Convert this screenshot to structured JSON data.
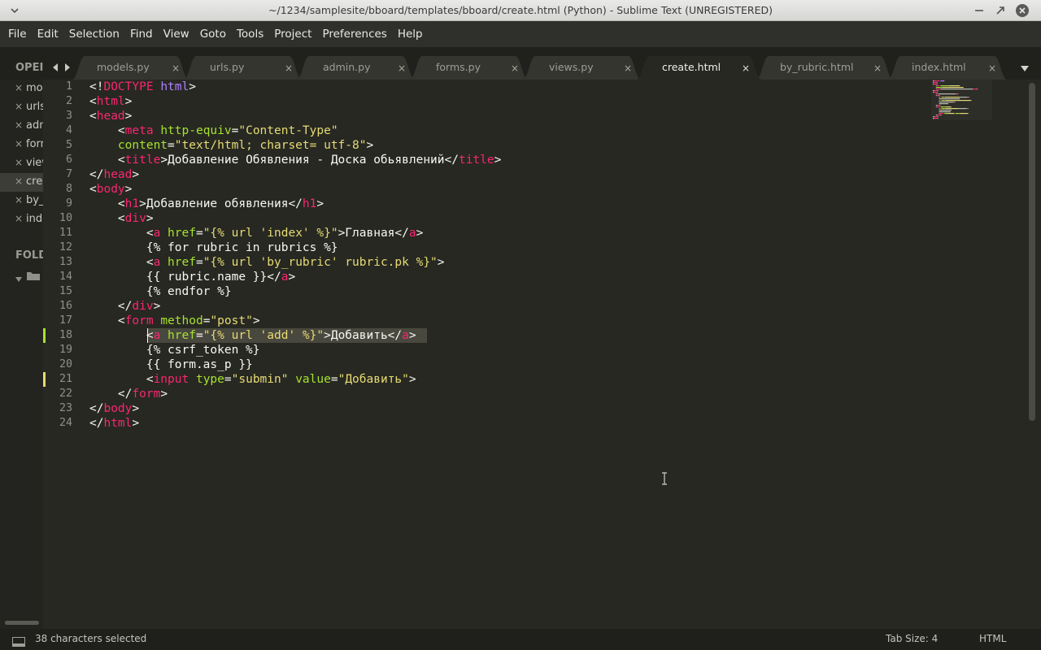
{
  "window": {
    "title": "~/1234/samplesite/bboard/templates/bboard/create.html (Python) - Sublime Text (UNREGISTERED)"
  },
  "menu": [
    "File",
    "Edit",
    "Selection",
    "Find",
    "View",
    "Goto",
    "Tools",
    "Project",
    "Preferences",
    "Help"
  ],
  "sidebar": {
    "open_label": "OPEI",
    "folders_label": "FOLD",
    "open_files": [
      {
        "name": "models.py",
        "active": false
      },
      {
        "name": "urls.py",
        "active": false
      },
      {
        "name": "admin.py",
        "active": false
      },
      {
        "name": "forms.py",
        "active": false
      },
      {
        "name": "views.py",
        "active": false
      },
      {
        "name": "create.html",
        "active": true
      },
      {
        "name": "by_rubric.html",
        "active": false
      },
      {
        "name": "index.html",
        "active": false
      }
    ]
  },
  "tabs": [
    {
      "label": "models.py",
      "active": false,
      "close": "×"
    },
    {
      "label": "urls.py",
      "active": false,
      "close": "×"
    },
    {
      "label": "admin.py",
      "active": false,
      "close": "×"
    },
    {
      "label": "forms.py",
      "active": false,
      "close": "×"
    },
    {
      "label": "views.py",
      "active": false,
      "close": "×"
    },
    {
      "label": "create.html",
      "active": true,
      "close": "×"
    },
    {
      "label": "by_rubric.html",
      "active": false,
      "close": "×"
    },
    {
      "label": "index.html",
      "active": false,
      "close": "×"
    }
  ],
  "editor": {
    "current_line": 18,
    "lines": [
      [
        [
          "p",
          "<!"
        ],
        [
          "t",
          "DOCTYPE"
        ],
        [
          "p",
          " "
        ],
        [
          "k",
          "html"
        ],
        [
          "p",
          ">"
        ]
      ],
      [
        [
          "p",
          "<"
        ],
        [
          "t",
          "html"
        ],
        [
          "p",
          ">"
        ]
      ],
      [
        [
          "p",
          "<"
        ],
        [
          "t",
          "head"
        ],
        [
          "p",
          ">"
        ]
      ],
      [
        [
          "p",
          "    <"
        ],
        [
          "t",
          "meta"
        ],
        [
          "p",
          " "
        ],
        [
          "a",
          "http-equiv"
        ],
        [
          "p",
          "="
        ],
        [
          "s",
          "\"Content-Type\""
        ]
      ],
      [
        [
          "p",
          "    "
        ],
        [
          "a",
          "content"
        ],
        [
          "p",
          "="
        ],
        [
          "s",
          "\"text/html; charset= utf-8\""
        ],
        [
          "p",
          ">"
        ]
      ],
      [
        [
          "p",
          "    <"
        ],
        [
          "t",
          "title"
        ],
        [
          "p",
          ">Добавление Обявления - Доска обьявлений</"
        ],
        [
          "t",
          "title"
        ],
        [
          "p",
          ">"
        ]
      ],
      [
        [
          "p",
          "</"
        ],
        [
          "t",
          "head"
        ],
        [
          "p",
          ">"
        ]
      ],
      [
        [
          "p",
          "<"
        ],
        [
          "t",
          "body"
        ],
        [
          "p",
          ">"
        ]
      ],
      [
        [
          "p",
          "    <"
        ],
        [
          "t",
          "h1"
        ],
        [
          "p",
          ">Добавление обявления</"
        ],
        [
          "t",
          "h1"
        ],
        [
          "p",
          ">"
        ]
      ],
      [
        [
          "p",
          "    <"
        ],
        [
          "t",
          "div"
        ],
        [
          "p",
          ">"
        ]
      ],
      [
        [
          "p",
          "        <"
        ],
        [
          "t",
          "a"
        ],
        [
          "p",
          " "
        ],
        [
          "a",
          "href"
        ],
        [
          "p",
          "="
        ],
        [
          "s",
          "\"{% url 'index' %}\""
        ],
        [
          "p",
          ">Главная</"
        ],
        [
          "t",
          "a"
        ],
        [
          "p",
          ">"
        ]
      ],
      [
        [
          "p",
          "        {% for rubric in rubrics %}"
        ]
      ],
      [
        [
          "p",
          "        <"
        ],
        [
          "t",
          "a"
        ],
        [
          "p",
          " "
        ],
        [
          "a",
          "href"
        ],
        [
          "p",
          "="
        ],
        [
          "s",
          "\"{% url 'by_rubric' rubric.pk %}\""
        ],
        [
          "p",
          ">"
        ]
      ],
      [
        [
          "p",
          "        {{ rubric.name }}</"
        ],
        [
          "t",
          "a"
        ],
        [
          "p",
          ">"
        ]
      ],
      [
        [
          "p",
          "        {% endfor %}"
        ]
      ],
      [
        [
          "p",
          "    </"
        ],
        [
          "t",
          "div"
        ],
        [
          "p",
          ">"
        ]
      ],
      [
        [
          "p",
          "    <"
        ],
        [
          "t",
          "form"
        ],
        [
          "p",
          " "
        ],
        [
          "a",
          "method"
        ],
        [
          "p",
          "="
        ],
        [
          "s",
          "\"post\""
        ],
        [
          "p",
          ">"
        ]
      ],
      [
        [
          "p",
          "        <"
        ],
        [
          "t",
          "a"
        ],
        [
          "p",
          " "
        ],
        [
          "a",
          "href"
        ],
        [
          "p",
          "="
        ],
        [
          "s",
          "\"{% url 'add' %}\""
        ],
        [
          "p",
          ">Добавить</"
        ],
        [
          "t",
          "a"
        ],
        [
          "p",
          ">"
        ]
      ],
      [
        [
          "p",
          "        {% csrf_token %}"
        ]
      ],
      [
        [
          "p",
          "        {{ form.as_p }}"
        ]
      ],
      [
        [
          "p",
          "        <"
        ],
        [
          "t",
          "input"
        ],
        [
          "p",
          " "
        ],
        [
          "a",
          "type"
        ],
        [
          "p",
          "="
        ],
        [
          "s",
          "\"submin\""
        ],
        [
          "p",
          " "
        ],
        [
          "a",
          "value"
        ],
        [
          "p",
          "="
        ],
        [
          "s",
          "\"Добавить\""
        ],
        [
          "p",
          ">"
        ]
      ],
      [
        [
          "p",
          "    </"
        ],
        [
          "t",
          "form"
        ],
        [
          "p",
          ">"
        ]
      ],
      [
        [
          "p",
          "</"
        ],
        [
          "t",
          "body"
        ],
        [
          "p",
          ">"
        ]
      ],
      [
        [
          "p",
          "</"
        ],
        [
          "t",
          "html"
        ],
        [
          "p",
          ">"
        ]
      ]
    ],
    "gutter_marks": [
      {
        "line": 18,
        "color": "#a6e22e"
      },
      {
        "line": 21,
        "color": "#e6db74"
      }
    ]
  },
  "statusbar": {
    "selection": "38 characters selected",
    "tab_size": "Tab Size: 4",
    "syntax": "HTML"
  },
  "colors": {
    "background": "#272822",
    "tag": "#f92672",
    "attribute": "#a6e22e",
    "string": "#e6db74",
    "keyword": "#ae81ff",
    "text": "#f8f8f2"
  }
}
